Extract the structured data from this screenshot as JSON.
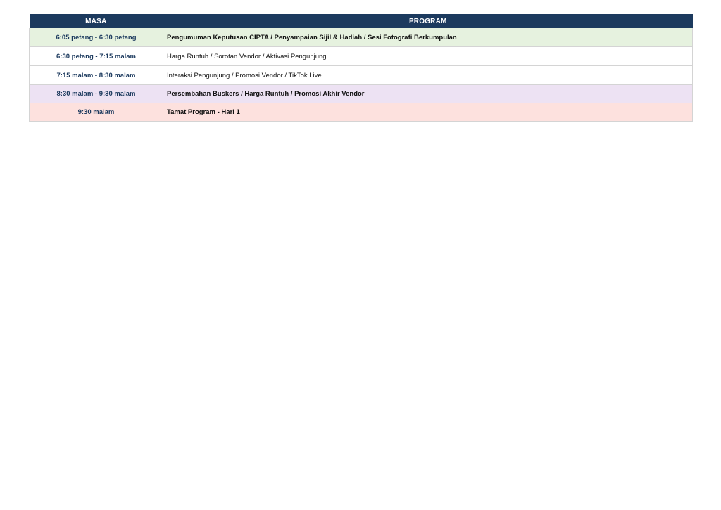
{
  "table": {
    "headers": {
      "time": "MASA",
      "program": "PROGRAM"
    },
    "rows": [
      {
        "time": "6:05 petang - 6:30 petang",
        "program": "Pengumuman Keputusan CIPTA / Penyampaian Sijil & Hadiah / Sesi Fotografi Berkumpulan",
        "bg": "#e6f2df",
        "bold": true
      },
      {
        "time": "6:30 petang - 7:15 malam",
        "program": "Harga Runtuh / Sorotan Vendor / Aktivasi Pengunjung",
        "bg": "#ffffff",
        "bold": false
      },
      {
        "time": "7:15 malam - 8:30 malam",
        "program": "Interaksi Pengunjung / Promosi Vendor / TikTok Live",
        "bg": "#ffffff",
        "bold": false
      },
      {
        "time": "8:30 malam - 9:30 malam",
        "program": "Persembahan Buskers / Harga Runtuh / Promosi Akhir Vendor",
        "bg": "#ede2f3",
        "bold": true
      },
      {
        "time": "9:30 malam",
        "program": "Tamat Program - Hari 1",
        "bg": "#fde1de",
        "bold": true
      }
    ]
  },
  "colors": {
    "header_bg": "#1c3a5e",
    "header_text": "#ffffff",
    "time_text": "#1c3a5e"
  }
}
